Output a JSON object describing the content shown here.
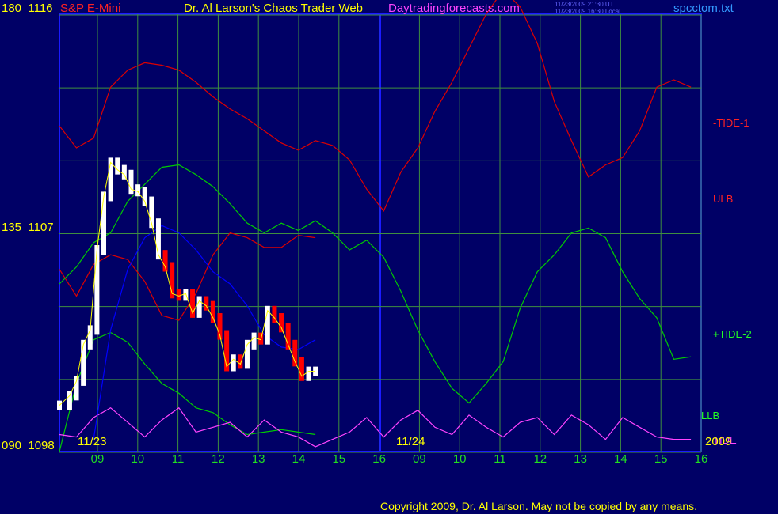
{
  "header": {
    "left_scale": "180",
    "left_price": "1116",
    "symbol": "S&P E-Mini",
    "site_title": "Dr. Al Larson's Chaos Trader Web",
    "site_url": "Daytradingforecasts.com",
    "stamp_ut": "11/23/2009 21:30 UT",
    "stamp_local": "11/23/2009 16:30 Local",
    "filename": "spcctom.txt"
  },
  "footer": {
    "copyright": "Copyright 2009, Dr. Al Larson. May not be copied by any means."
  },
  "colors": {
    "background": "#000066",
    "grid": "#3f8f3f",
    "price_up": "#ffffff",
    "price_down": "#ff0000",
    "avg": "#ffff00",
    "red_band": "#dd0000",
    "green_band": "#00cc00",
    "blue_curve": "#0000ff",
    "magenta_cycle": "#ff44ff"
  },
  "chart_data": {
    "type": "line",
    "price_axis": {
      "ylim": [
        1098,
        1116
      ],
      "tick_labels": [
        {
          "scale": "180",
          "price": "1116"
        },
        {
          "scale": "135",
          "price": "1107"
        },
        {
          "scale": "090",
          "price": "1098"
        }
      ]
    },
    "x_hour_labels": [
      "09",
      "10",
      "11",
      "12",
      "13",
      "14",
      "15",
      "16",
      "09",
      "10",
      "11",
      "12",
      "13",
      "14",
      "15",
      "16"
    ],
    "date_labels": [
      "11/23",
      "11/24"
    ],
    "year_label": "2009",
    "line_labels": [
      "-TIDE-1",
      "ULB",
      "+TIDE-2",
      "LLB",
      "TIDE"
    ],
    "series": [
      {
        "name": "-TIDE-1",
        "color": "#dd0000",
        "x": [
          8.5,
          9,
          9.5,
          10,
          10.5,
          11,
          11.5,
          12,
          12.5,
          13,
          13.5,
          14,
          14.5,
          15,
          15.5,
          16,
          16.5,
          17,
          17.5,
          18,
          18.5,
          19,
          19.5,
          20,
          20.5,
          21,
          21.5,
          22,
          22.5,
          23,
          23.5,
          24,
          24.5,
          25,
          25.5,
          26,
          26.5,
          27
        ],
        "y": [
          1111.4,
          1110.5,
          1110.9,
          1113.0,
          1113.7,
          1114.0,
          1113.9,
          1113.7,
          1113.2,
          1112.6,
          1112.1,
          1111.7,
          1111.2,
          1110.7,
          1110.4,
          1110.8,
          1110.6,
          1110.0,
          1108.8,
          1107.9,
          1109.5,
          1110.5,
          1112.0,
          1113.2,
          1114.6,
          1116.0,
          1117.0,
          1116.3,
          1114.8,
          1112.4,
          1110.8,
          1109.3,
          1109.8,
          1110.1,
          1111.2,
          1113.0,
          1113.3,
          1113.0
        ]
      },
      {
        "name": "ULB",
        "color": "#dd0000",
        "x": [
          8.5,
          9,
          9.5,
          10,
          10.5,
          11,
          11.5,
          12,
          12.5,
          13,
          13.5,
          14,
          14.5,
          15,
          15.5,
          16
        ],
        "y": [
          1105.5,
          1104.4,
          1105.7,
          1106.1,
          1105.9,
          1105.0,
          1103.6,
          1103.4,
          1104.5,
          1106.1,
          1107.0,
          1106.8,
          1106.4,
          1106.4,
          1106.9,
          1106.8
        ]
      },
      {
        "name": "+TIDE-2",
        "color": "#00cc00",
        "x": [
          8.5,
          9,
          9.5,
          10,
          10.5,
          11,
          11.5,
          12,
          12.5,
          13,
          13.5,
          14,
          14.5,
          15,
          15.5,
          16,
          16.5,
          17,
          17.5,
          18,
          18.5,
          19,
          19.5,
          20,
          20.5,
          21,
          21.5,
          22,
          22.5,
          23,
          23.5,
          24,
          24.5,
          25,
          25.5,
          26,
          26.5,
          27
        ],
        "y": [
          1104.9,
          1105.6,
          1106.6,
          1107.0,
          1108.3,
          1109.0,
          1109.7,
          1109.8,
          1109.4,
          1108.9,
          1108.2,
          1107.4,
          1107.0,
          1107.4,
          1107.1,
          1107.5,
          1107.0,
          1106.3,
          1106.7,
          1106.0,
          1104.6,
          1103.0,
          1101.7,
          1100.6,
          1100.0,
          1100.8,
          1101.7,
          1103.9,
          1105.4,
          1106.1,
          1107.0,
          1107.2,
          1106.8,
          1105.4,
          1104.3,
          1103.5,
          1101.8,
          1101.9
        ]
      },
      {
        "name": "LLB",
        "color": "#00cc00",
        "x": [
          8.5,
          9,
          9.5,
          10,
          10.5,
          11,
          11.5,
          12,
          12.5,
          13,
          13.5,
          14,
          14.5,
          15,
          15.5,
          16
        ],
        "y": [
          1098,
          1100.8,
          1102.6,
          1102.9,
          1102.5,
          1101.6,
          1100.8,
          1100.4,
          1099.8,
          1099.6,
          1099.1,
          1098.7,
          1098.8,
          1098.9,
          1098.8,
          1098.7
        ]
      },
      {
        "name": "TIDE",
        "color": "#ff44ff",
        "x": [
          8.5,
          9,
          9.5,
          10,
          10.5,
          11,
          11.5,
          12,
          12.5,
          13,
          13.5,
          14,
          14.5,
          15,
          15.5,
          16,
          16.5,
          17,
          17.5,
          18,
          18.5,
          19,
          19.5,
          20,
          20.5,
          21,
          21.5,
          22,
          22.5,
          23,
          23.5,
          24,
          24.5,
          25,
          25.5,
          26,
          26.5,
          27
        ],
        "y": [
          1098.7,
          1098.6,
          1099.4,
          1099.8,
          1099.2,
          1098.6,
          1099.3,
          1099.8,
          1098.8,
          1099.0,
          1099.2,
          1098.6,
          1099.3,
          1098.8,
          1098.6,
          1098.2,
          1098.5,
          1098.8,
          1099.4,
          1098.6,
          1099.3,
          1099.7,
          1099.0,
          1098.7,
          1099.5,
          1099.0,
          1098.6,
          1099.2,
          1099.4,
          1098.7,
          1099.5,
          1099.1,
          1098.5,
          1099.4,
          1099.0,
          1098.6,
          1098.5,
          1098.5
        ]
      },
      {
        "name": "avg",
        "color": "#0000ff",
        "x": [
          9.5,
          10,
          10.5,
          11,
          11.5,
          12,
          12.5,
          13,
          13.5,
          14,
          14.5,
          15,
          15.5,
          16
        ],
        "y": [
          1098.5,
          1103.0,
          1105.5,
          1106.8,
          1107.3,
          1107.0,
          1106.3,
          1105.4,
          1104.9,
          1104.0,
          1102.8,
          1102.3,
          1102.2,
          1102.6
        ]
      },
      {
        "name": "price",
        "color": "#ffffff",
        "x": [
          8.5,
          8.8,
          9,
          9.2,
          9.4,
          9.6,
          9.8,
          10,
          10.2,
          10.4,
          10.6,
          10.8,
          11,
          11.2,
          11.4,
          11.6,
          11.8,
          12,
          12.2,
          12.4,
          12.6,
          12.8,
          13,
          13.2,
          13.4,
          13.6,
          13.8,
          14,
          14.2,
          14.4,
          14.6,
          14.8,
          15,
          15.2,
          15.4,
          15.6,
          15.8,
          16
        ],
        "y": [
          1099.9,
          1100.3,
          1100.9,
          1102.4,
          1103.0,
          1106.3,
          1108.5,
          1109.9,
          1109.6,
          1109.4,
          1108.8,
          1108.7,
          1108.3,
          1107.4,
          1106.1,
          1105.6,
          1104.5,
          1104.4,
          1104.5,
          1103.7,
          1104.2,
          1104.0,
          1103.5,
          1102.8,
          1101.5,
          1101.8,
          1101.6,
          1102.4,
          1102.7,
          1102.6,
          1103.8,
          1103.5,
          1103.1,
          1102.4,
          1101.7,
          1101.1,
          1101.3,
          1101.3
        ]
      }
    ]
  }
}
